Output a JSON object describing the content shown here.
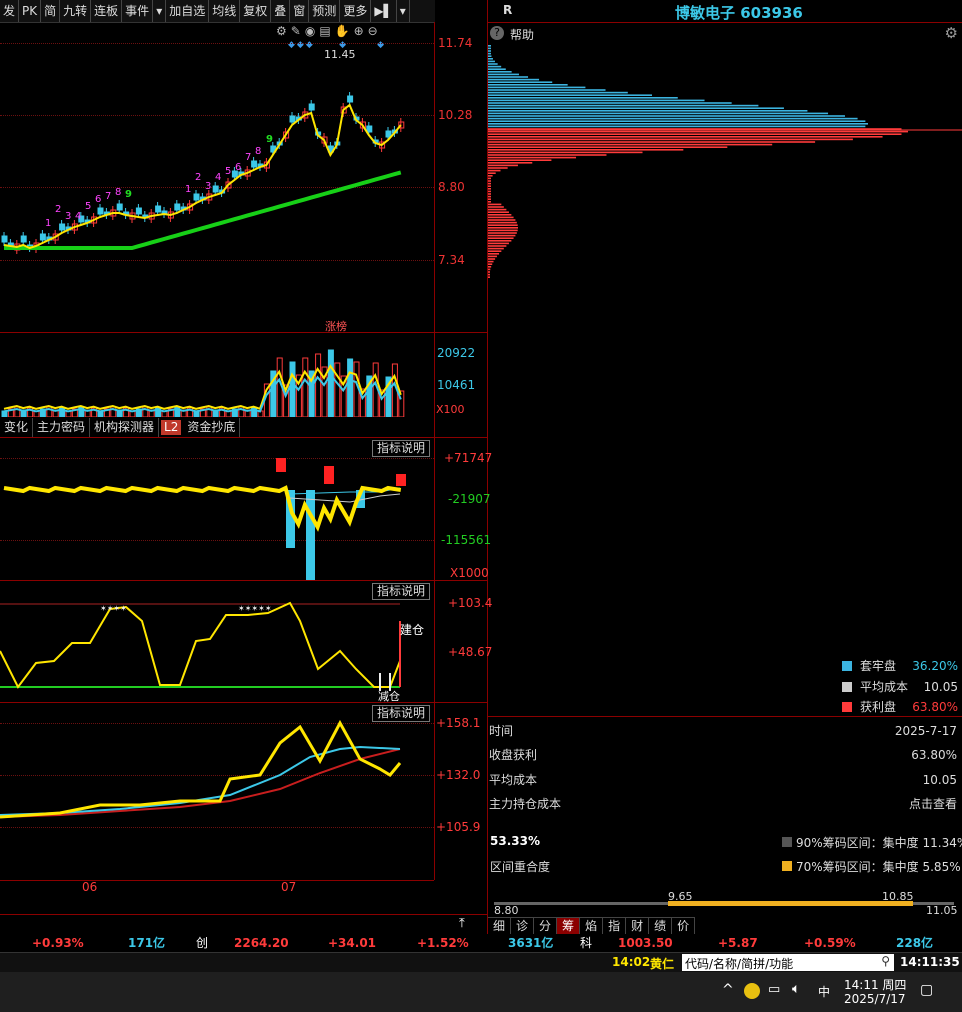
{
  "toolbar": {
    "items": [
      "发",
      "PK",
      "简",
      "九转",
      "连板",
      "事件",
      "▾",
      "加自选",
      "均线",
      "复权",
      "叠",
      "窗",
      "预测",
      "更多",
      "▶▌",
      "▾"
    ]
  },
  "stock": {
    "left_label": "R",
    "title": "博敏电子 603936"
  },
  "help": {
    "label": "帮助"
  },
  "price_axis": {
    "labels": [
      "11.74",
      "10.28",
      "8.80",
      "7.34"
    ],
    "high_marker": "11.45"
  },
  "tdsequence_marks": {
    "group1": [
      "1",
      "2",
      "3",
      "4",
      "5",
      "6",
      "7",
      "8",
      "9"
    ],
    "group2": [
      "1",
      "2",
      "3",
      "4",
      "5",
      "6",
      "7",
      "8",
      "9"
    ]
  },
  "zhangbang_label": "涨榜",
  "volume": {
    "labels": [
      "20922",
      "10461"
    ],
    "unit": "X100"
  },
  "tabs": [
    "变化",
    "主力密码",
    "机构探测器",
    "L2",
    "资金抄底"
  ],
  "indicator_btn": "指标说明",
  "money_axis": {
    "labels": [
      "+71747",
      "-21907",
      "-115561"
    ],
    "unit": "X1000"
  },
  "osc_axis": {
    "labels": [
      "+103.4",
      "+48.67"
    ],
    "build": "建仓",
    "sell": "减仓"
  },
  "ma_axis": {
    "labels": [
      "+158.1",
      "+132.0",
      "+105.9"
    ]
  },
  "x_axis": {
    "labels": [
      "06",
      "07"
    ]
  },
  "chips": {
    "legend": [
      {
        "label": "套牢盘",
        "value": "36.20%",
        "color": "#3cb4e0"
      },
      {
        "label": "平均成本",
        "value": "10.05",
        "color": "#cccccc"
      },
      {
        "label": "获利盘",
        "value": "63.80%",
        "color": "#ff3b3b"
      }
    ],
    "rows": [
      {
        "k": "时间",
        "v": "2025-7-17"
      },
      {
        "k": "收盘获利",
        "v": "63.80%"
      },
      {
        "k": "平均成本",
        "v": "10.05"
      },
      {
        "k": "主力持仓成本",
        "v": "点击查看"
      }
    ],
    "concentration_pct": "53.33%",
    "overlap_label": "区间重合度",
    "c90": "90%筹码区间：集中度 11.34%",
    "c70": "70%筹码区间：集中度 5.85%",
    "range": {
      "low": "8.80",
      "high": "11.05",
      "r_low": "9.65",
      "r_high": "10.85"
    },
    "bottom_tabs": [
      "细",
      "诊",
      "分",
      "筹",
      "焰",
      "指",
      "财",
      "绩",
      "价"
    ]
  },
  "status": {
    "items": [
      {
        "t": "+0.93%",
        "c": "red"
      },
      {
        "t": "171亿",
        "c": "cyan"
      },
      {
        "t": "创",
        "c": "white"
      },
      {
        "t": "2264.20",
        "c": "red"
      },
      {
        "t": "+34.01",
        "c": "red"
      },
      {
        "t": "+1.52%",
        "c": "red"
      },
      {
        "t": "3631亿",
        "c": "cyan"
      },
      {
        "t": "科",
        "c": "white"
      },
      {
        "t": "1003.50",
        "c": "red"
      },
      {
        "t": "+5.87",
        "c": "red"
      },
      {
        "t": "+0.59%",
        "c": "red"
      },
      {
        "t": "228亿",
        "c": "cyan"
      }
    ]
  },
  "news": {
    "time": "14:02",
    "text": "黄仁"
  },
  "search": {
    "placeholder": "代码/名称/简拼/功能"
  },
  "clock": "14:11:35",
  "taskbar": {
    "ime": "中",
    "time": "14:11 周四",
    "date": "2025/7/17"
  }
}
